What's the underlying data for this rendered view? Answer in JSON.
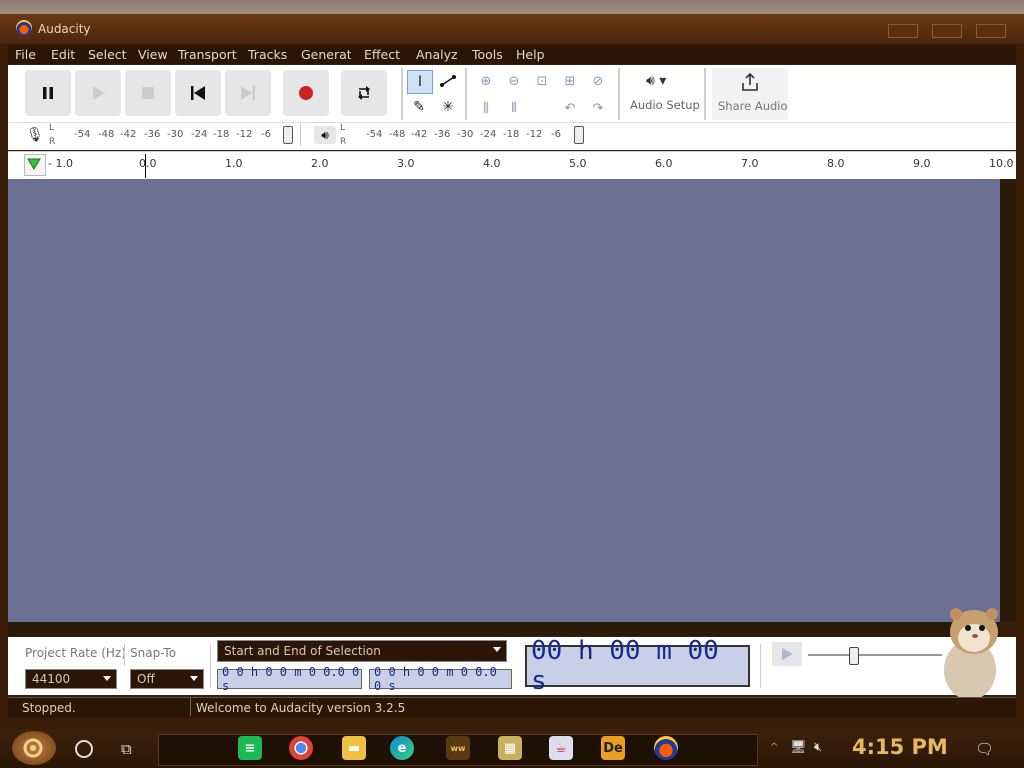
{
  "window": {
    "title": "Audacity"
  },
  "menu": [
    "File",
    "Edit",
    "Select",
    "View",
    "Transport",
    "Tracks",
    "Generate",
    "Effect",
    "Analyze",
    "Tools",
    "Help"
  ],
  "toolbar": {
    "audio_setup_label": "Audio Setup",
    "share_audio_label": "Share Audio"
  },
  "meters": {
    "scale": [
      "-54",
      "-48",
      "-42",
      "-36",
      "-30",
      "-24",
      "-18",
      "-12",
      "-6"
    ],
    "l": "L",
    "r": "R"
  },
  "ruler": {
    "ticks": [
      "- 1.0",
      "0.0",
      "1.0",
      "2.0",
      "3.0",
      "4.0",
      "5.0",
      "6.0",
      "7.0",
      "8.0",
      "9.0",
      "10.0"
    ]
  },
  "bottom": {
    "project_rate_label": "Project Rate (Hz)",
    "project_rate_value": "44100",
    "snap_to_label": "Snap-To",
    "snap_to_value": "Off",
    "selection_mode": "Start and End of Selection",
    "selection_start": "0 0 h 0 0 m 0 0.0 0 s",
    "selection_end": "0 0 h 0 0 m 0 0.0 0 s",
    "big_time": "00 h 00 m 00 s"
  },
  "status": {
    "left": "Stopped.",
    "message": "Welcome to Audacity version 3.2.5"
  },
  "taskbar": {
    "clock": "4:15 PM"
  },
  "colors": {
    "track_bg": "#6b6f91",
    "accent_record": "#cc2222",
    "frame": "#3a1e0a"
  }
}
